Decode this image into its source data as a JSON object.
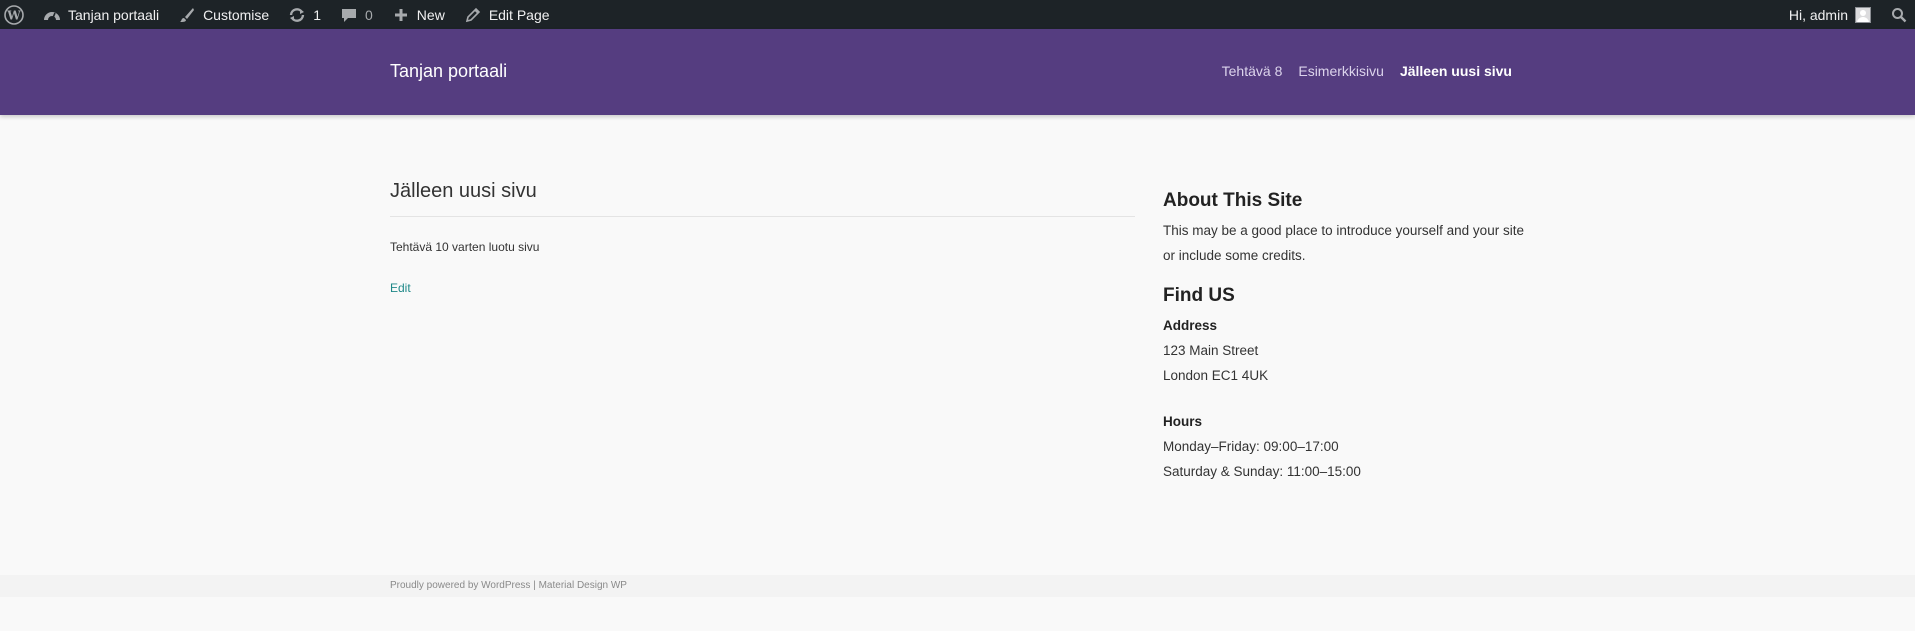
{
  "admin_bar": {
    "wp_logo_icon": "wordpress-icon",
    "site_name": "Tanjan portaali",
    "customise_label": "Customise",
    "updates_count": "1",
    "comments_count": "0",
    "new_label": "New",
    "edit_page_label": "Edit Page",
    "greeting": "Hi, admin",
    "search_icon": "search-icon"
  },
  "header": {
    "site_title": "Tanjan portaali",
    "nav": [
      {
        "label": "Tehtävä 8"
      },
      {
        "label": "Esimerkkisivu"
      },
      {
        "label": "Jälleen uusi sivu"
      }
    ],
    "background_color": "#553d80"
  },
  "page": {
    "title": "Jälleen uusi sivu",
    "body": "Tehtävä 10 varten luotu sivu",
    "edit_link": "Edit",
    "link_color": "#1e8888"
  },
  "sidebar": {
    "about_title": "About This Site",
    "about_text": "This may be a good place to introduce yourself and your site or include some credits.",
    "find_title": "Find US",
    "address_label": "Address",
    "address_line1": "123 Main Street",
    "address_line2": "London EC1 4UK",
    "hours_label": "Hours",
    "hours_line1": "Monday–Friday: 09:00–17:00",
    "hours_line2": "Saturday & Sunday: 11:00–15:00"
  },
  "footer": {
    "powered_text": "Proudly powered by WordPress",
    "separator": " | ",
    "theme_link": "Material Design WP"
  }
}
